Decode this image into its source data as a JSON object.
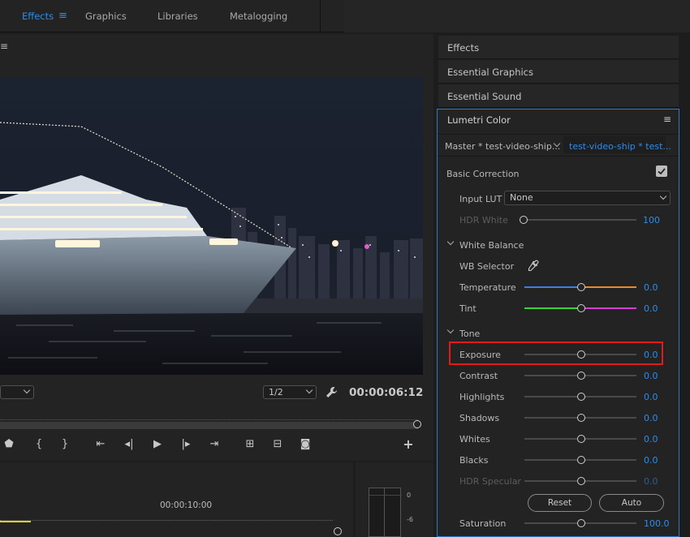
{
  "workspace": {
    "tabs": [
      {
        "label": "Effects",
        "active": true
      },
      {
        "label": "Graphics",
        "active": false
      },
      {
        "label": "Libraries",
        "active": false
      },
      {
        "label": "Metalogging",
        "active": false
      }
    ]
  },
  "program_monitor": {
    "scale_value": "",
    "resolution_value": "1/2",
    "timecode": "00:00:06:12"
  },
  "timeline": {
    "time_marker": "00:00:10:00",
    "meter_scale": [
      "0",
      "-6"
    ]
  },
  "right_panel": {
    "collapsed_sections": [
      "Effects",
      "Essential Graphics",
      "Essential Sound"
    ],
    "lumetri": {
      "title": "Lumetri Color",
      "master_tab": "Master * test-video-ship...",
      "clip_tab": "test-video-ship * test...",
      "section_title": "Basic Correction",
      "input_lut_label": "Input LUT",
      "input_lut_value": "None",
      "hdr_white_label": "HDR White",
      "hdr_white_value": "100",
      "white_balance_label": "White Balance",
      "wb_selector_label": "WB Selector",
      "temperature": {
        "label": "Temperature",
        "value": "0.0"
      },
      "tint": {
        "label": "Tint",
        "value": "0.0"
      },
      "tone_label": "Tone",
      "exposure": {
        "label": "Exposure",
        "value": "0.0"
      },
      "contrast": {
        "label": "Contrast",
        "value": "0.0"
      },
      "highlights": {
        "label": "Highlights",
        "value": "0.0"
      },
      "shadows": {
        "label": "Shadows",
        "value": "0.0"
      },
      "whites": {
        "label": "Whites",
        "value": "0.0"
      },
      "blacks": {
        "label": "Blacks",
        "value": "0.0"
      },
      "hdr_specular": {
        "label": "HDR Specular",
        "value": "0.0"
      },
      "reset_label": "Reset",
      "auto_label": "Auto",
      "saturation": {
        "label": "Saturation",
        "value": "100.0"
      }
    }
  },
  "colors": {
    "accent": "#2d8ceb",
    "highlight_box": "#e01b1b",
    "temperature_left": "#3f7fe0",
    "temperature_right": "#e68a2e",
    "tint_left": "#3fcf3f",
    "tint_right": "#d23fd2",
    "playhead": "#e6d21f"
  }
}
